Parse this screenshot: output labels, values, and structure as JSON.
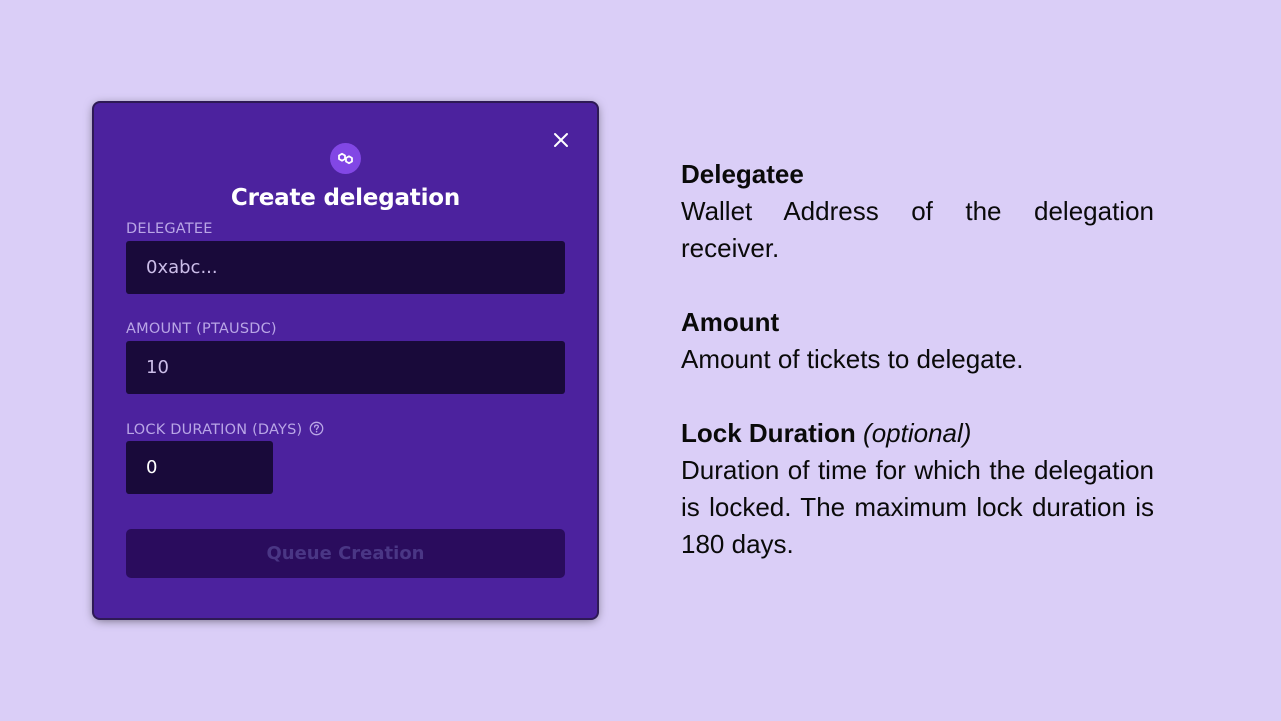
{
  "modal": {
    "title": "Create delegation",
    "fields": [
      {
        "label": "DELEGATEE",
        "value": "0xabc..."
      },
      {
        "label": "AMOUNT (PTAUSDC)",
        "value": "10"
      },
      {
        "label": "LOCK DURATION (DAYS)",
        "value": "0"
      }
    ],
    "submit_label": "Queue Creation",
    "icons": {
      "close": "close-icon",
      "network": "polygon-icon",
      "help": "question-circle-icon"
    }
  },
  "explanations": [
    {
      "heading": "Delegatee",
      "qualifier": "",
      "text": "Wallet Address of the delegation receiver."
    },
    {
      "heading": "Amount",
      "qualifier": "",
      "text": "Amount of tickets to delegate."
    },
    {
      "heading": "Lock Duration",
      "qualifier": "(optional)",
      "text": "Duration of time for which the delegation is locked. The maximum lock duration is 180 days."
    }
  ],
  "colors": {
    "page_background": "#dacef7",
    "modal_background": "#4c229e",
    "input_background": "#190a3a",
    "button_background": "#2a0c5d",
    "accent": "#8247e5"
  }
}
